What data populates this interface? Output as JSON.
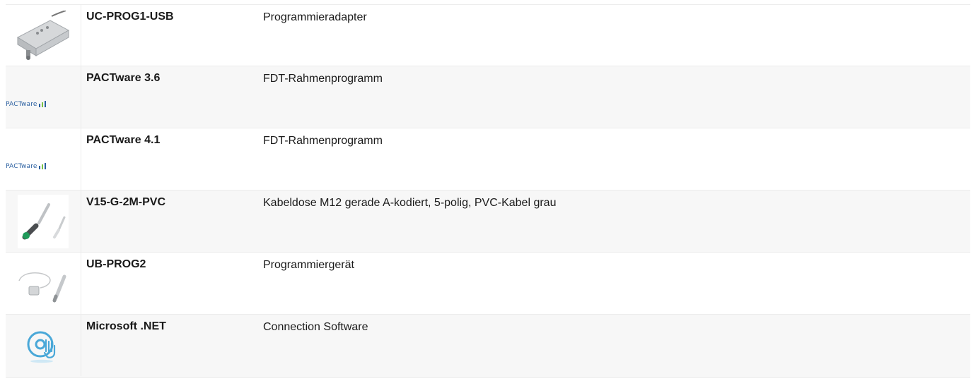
{
  "rows": [
    {
      "name": "UC-PROG1-USB",
      "description": "Programmieradapter",
      "icon": "usb-adapter-image"
    },
    {
      "name": "PACTware 3.6",
      "description": "FDT-Rahmenprogramm",
      "icon": "pactware-logo",
      "logo_text": "PACTware"
    },
    {
      "name": "PACTware 4.1",
      "description": "FDT-Rahmenprogramm",
      "icon": "pactware-logo",
      "logo_text": "PACTware"
    },
    {
      "name": "V15-G-2M-PVC",
      "description": "Kabeldose M12 gerade A-kodiert, 5-polig, PVC-Kabel grau",
      "icon": "cable-socket-image"
    },
    {
      "name": "UB-PROG2",
      "description": "Programmiergerät",
      "icon": "programmer-device-image"
    },
    {
      "name": "Microsoft .NET",
      "description": "Connection Software",
      "icon": "software-cd-icon"
    }
  ],
  "colors": {
    "row_alt_bg": "#f7f7f7",
    "row_bg": "#ffffff",
    "text": "#1a1a1a",
    "logo_blue": "#2a5fa0",
    "cd_blue": "#4aa8d8"
  }
}
